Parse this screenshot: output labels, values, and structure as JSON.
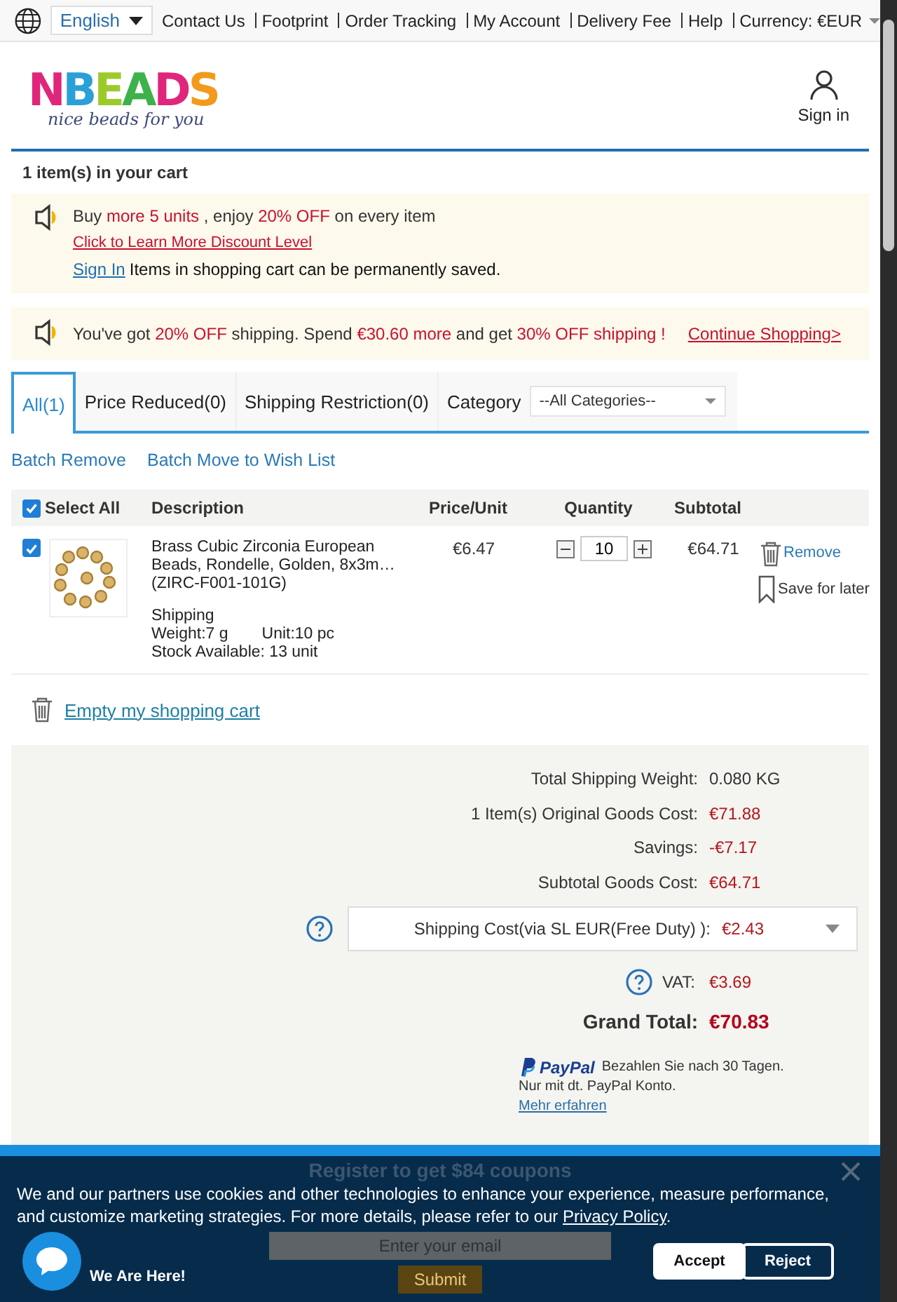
{
  "top_bar": {
    "language": "English",
    "links": [
      "Contact Us",
      "Footprint",
      "Order Tracking",
      "My Account",
      "Delivery Fee",
      "Help"
    ],
    "currency": "Currency: €EUR"
  },
  "header": {
    "logo": "NBEADS",
    "tagline": "nice beads for you",
    "sign_in": "Sign in"
  },
  "cart_count": "1 item(s) in your cart",
  "discount_notice": {
    "text": "Buy **more 5 units** , enjoy **20% OFF** on every item",
    "discount_link": "Click to Learn More Discount Level",
    "sign_in_link": "Sign In",
    "sign_in_note": "Items in shopping cart can be permanently saved."
  },
  "shipping_notice": {
    "text": "You've got **20% OFF** shipping. Spend **€30.60 more** and get **30% OFF shipping !**",
    "continue_link": "Continue Shopping>"
  },
  "tabs": [
    {
      "label": "All(1)",
      "selected": true
    },
    {
      "label": "Price Reduced(0)",
      "selected": false
    },
    {
      "label": "Shipping Restriction(0)",
      "selected": false
    }
  ],
  "category": {
    "label": "Category",
    "value": "--All Categories--"
  },
  "batch_actions": [
    "Batch Remove",
    "Batch Move to Wish List"
  ],
  "table": {
    "select_all": {
      "label": "Select All",
      "checked": true
    },
    "columns": [
      "Description",
      "Price/Unit",
      "Quantity",
      "Subtotal"
    ],
    "rows": [
      {
        "checked": true,
        "description": "Brass Cubic Zirconia European Beads, Rondelle, Golden, 8x3m…",
        "code": "(ZIRC-F001-101G)",
        "shipping": "Shipping",
        "weight": "Weight:7 g",
        "unit": "Unit:10  pc",
        "stock": "Stock Available: 13 unit",
        "price": "€6.47",
        "quantity": "10",
        "subtotal": "€64.71",
        "remove": "Remove",
        "save": "Save for later"
      }
    ]
  },
  "empty_cart": "Empty my shopping cart",
  "summary": [
    {
      "kind": "plain",
      "label": "Total Shipping Weight:",
      "value": "0.080 KG"
    },
    {
      "kind": "price",
      "label": "1 Item(s) Original Goods Cost:",
      "value": "€71.88"
    },
    {
      "kind": "price",
      "label": "Savings:",
      "value": "-€7.17"
    },
    {
      "kind": "price",
      "label": "Subtotal Goods Cost:",
      "value": "€64.71"
    },
    {
      "kind": "select",
      "label": "Shipping Cost(via SL EUR(Free Duty) ):",
      "value": "€2.43"
    },
    {
      "kind": "help",
      "label": "VAT:",
      "value": "€3.69"
    },
    {
      "kind": "total",
      "label": "Grand Total:",
      "value": "€70.83"
    }
  ],
  "paypal": {
    "brand": "PayPal",
    "note": "Bezahlen Sie nach 30 Tagen.",
    "note2": "Nur mit dt. PayPal Konto.",
    "link": "Mehr erfahren"
  },
  "popup": {
    "title": "Register to get $84 coupons",
    "email_placeholder": "Enter your email",
    "submit": "Submit"
  },
  "cookie": {
    "text": "We and our partners use cookies and other technologies to enhance your experience, measure performance, and customize marketing strategies. For more details, please refer to our ",
    "link": "Privacy Policy",
    "text_end": ".",
    "accept": "Accept",
    "reject": "Reject"
  },
  "chat": {
    "label": "We Are Here!"
  }
}
